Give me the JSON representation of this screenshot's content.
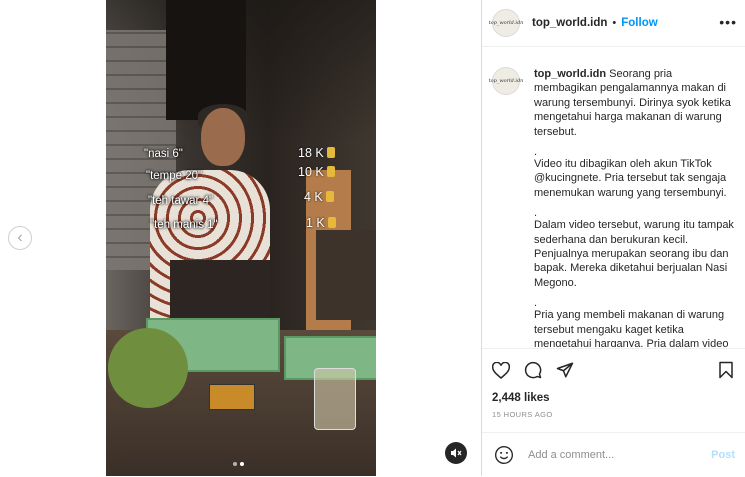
{
  "media": {
    "price_list": [
      {
        "item": "\"nasi 6\"",
        "price": "18 K"
      },
      {
        "item": "\"tempe 20\"",
        "price": "10 K"
      },
      {
        "item": "\"teh tawar 4\"",
        "price": "4 K"
      },
      {
        "item": "\"teh manis 1\"",
        "price": "1 K"
      }
    ],
    "mute_icon": "volume-mute-icon",
    "prev_icon": "chevron-left-icon",
    "carousel_dots": 2,
    "active_dot": 1
  },
  "header": {
    "avatar_text": "top_world.idn",
    "username": "top_world.idn",
    "separator": "•",
    "follow_label": "Follow",
    "more_icon": "more-options-icon"
  },
  "caption": {
    "avatar_text": "top_world.idn",
    "username": "top_world.idn",
    "first_text": "Seorang pria membagikan pengalamannya makan di warung tersembunyi. Dirinya syok ketika mengetahui harga makanan di warung tersebut.",
    "sep1": ".",
    "para2": "Video itu dibagikan oleh akun TikTok @kucingnete. Pria tersebut tak sengaja menemukan warung yang tersembunyi.",
    "sep2": ".",
    "para3": "Dalam video tersebut, warung itu tampak sederhana dan berukuran kecil. Penjualnya merupakan seorang ibu dan bapak. Mereka diketahui berjualan Nasi Megono.",
    "sep3": ".",
    "para4": "Pria yang membeli makanan di warung tersebut mengaku kaget ketika mengetahui harganya. Pria dalam video tersebut tampak menyantap makanan"
  },
  "actions": {
    "like_icon": "heart-icon",
    "comment_icon": "comment-icon",
    "share_icon": "share-icon",
    "save_icon": "bookmark-icon"
  },
  "stats": {
    "likes": "2,448 likes",
    "time": "15 HOURS AGO"
  },
  "comment": {
    "emoji_icon": "emoji-icon",
    "placeholder": "Add a comment...",
    "post_label": "Post"
  }
}
